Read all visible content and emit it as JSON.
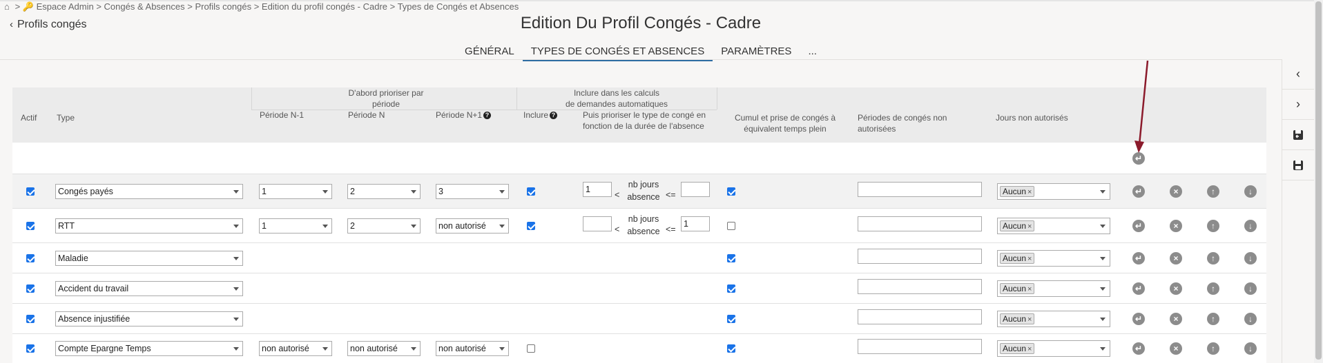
{
  "breadcrumb": {
    "text": "> 🔑 Espace Admin > Congés & Absences > Profils congés > Edition du profil congés - Cadre > Types de Congés et Absences"
  },
  "back_link": {
    "label": "Profils congés"
  },
  "page_title": "Edition Du Profil Congés - Cadre",
  "tabs": [
    {
      "label": "GÉNÉRAL"
    },
    {
      "label": "TYPES DE CONGÉS ET ABSENCES"
    },
    {
      "label": "PARAMÈTRES"
    },
    {
      "label": "..."
    }
  ],
  "table": {
    "headers": {
      "actif": "Actif",
      "type": "Type",
      "group1": "D'abord prioriser par période",
      "periode_n1": "Période N-1",
      "periode_n": "Période N",
      "periode_np1": "Période N+1",
      "group2_line1": "Inclure dans les calculs",
      "group2_line2": "de demandes automatiques",
      "inclure": "Inclure",
      "prioriser": "Puis prioriser le type de congé en fonction de la durée de l'absence",
      "cumul": "Cumul et prise de congés à équivalent temps plein",
      "periodes_non_auto": "Périodes de congés non autorisées",
      "jours_non_auto": "Jours non autorisés"
    },
    "range_label_lt": "<",
    "range_label_le": "<=",
    "range_label_mid": "nb jours absence",
    "rows": [
      {
        "type": "Congés payés",
        "actif": true,
        "n1": "1",
        "n": "2",
        "np1": "3",
        "inclure": true,
        "min": "1",
        "max": "",
        "cumul": true,
        "periodes": "",
        "jours": "Aucun"
      },
      {
        "type": "RTT",
        "actif": true,
        "n1": "1",
        "n": "2",
        "np1": "non autorisé",
        "inclure": true,
        "min": "",
        "max": "1",
        "cumul": false,
        "periodes": "",
        "jours": "Aucun"
      },
      {
        "type": "Maladie",
        "actif": true,
        "cumul": true,
        "periodes": "",
        "jours": "Aucun"
      },
      {
        "type": "Accident du travail",
        "actif": true,
        "cumul": true,
        "periodes": "",
        "jours": "Aucun"
      },
      {
        "type": "Absence injustifiée",
        "actif": true,
        "cumul": true,
        "periodes": "",
        "jours": "Aucun"
      },
      {
        "type": "Compte Epargne Temps",
        "actif": true,
        "n1": "non autorisé",
        "n": "non autorisé",
        "np1": "non autorisé",
        "inclure": false,
        "cumul": true,
        "periodes": "",
        "jours": "Aucun"
      }
    ]
  },
  "colors": {
    "accent": "#2d6ca2",
    "arrow": "#8b1a2b",
    "checkbox": "#1a73e8"
  },
  "icons": [
    "home-icon",
    "key-icon",
    "chevron-left-icon",
    "chevron-right-icon",
    "undo-icon",
    "close-icon",
    "arrow-up-icon",
    "arrow-down-icon",
    "save-return-icon",
    "save-icon",
    "help-icon"
  ]
}
